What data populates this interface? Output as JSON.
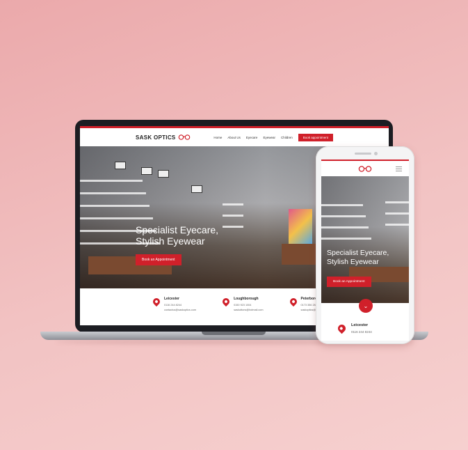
{
  "brand": {
    "name": "SASK OPTICS",
    "accent": "#d0202a"
  },
  "laptop_site": {
    "nav": [
      "Home",
      "About Us",
      "Eyecare",
      "Eyewear",
      "Children"
    ],
    "book_label": "Book appointment",
    "hero": {
      "line1": "Specialist Eyecare,",
      "line2": "Stylish Eyewear",
      "button": "Book an Appointment"
    },
    "locations": [
      {
        "name": "Leicester",
        "phone": "0116 244 8244",
        "email": "contactus@saskoptics.com"
      },
      {
        "name": "Loughborough",
        "phone": "0150 923 1004",
        "email": "saskuttons@hotmail.com"
      },
      {
        "name": "Peterborough",
        "phone": "0173 356 2846",
        "email": "saskoptics@outlook.com"
      }
    ]
  },
  "phone_site": {
    "hero": {
      "line1": "Specialist Eyecare,",
      "line2": "Stylish Eyewear",
      "button": "Book an Appointment"
    },
    "location": {
      "name": "Leicester",
      "phone": "0116 244 8244"
    }
  },
  "icons": {
    "glasses": "glasses-icon",
    "pin": "map-pin-icon",
    "menu": "hamburger-menu-icon",
    "scroll": "chevron-down-icon"
  }
}
